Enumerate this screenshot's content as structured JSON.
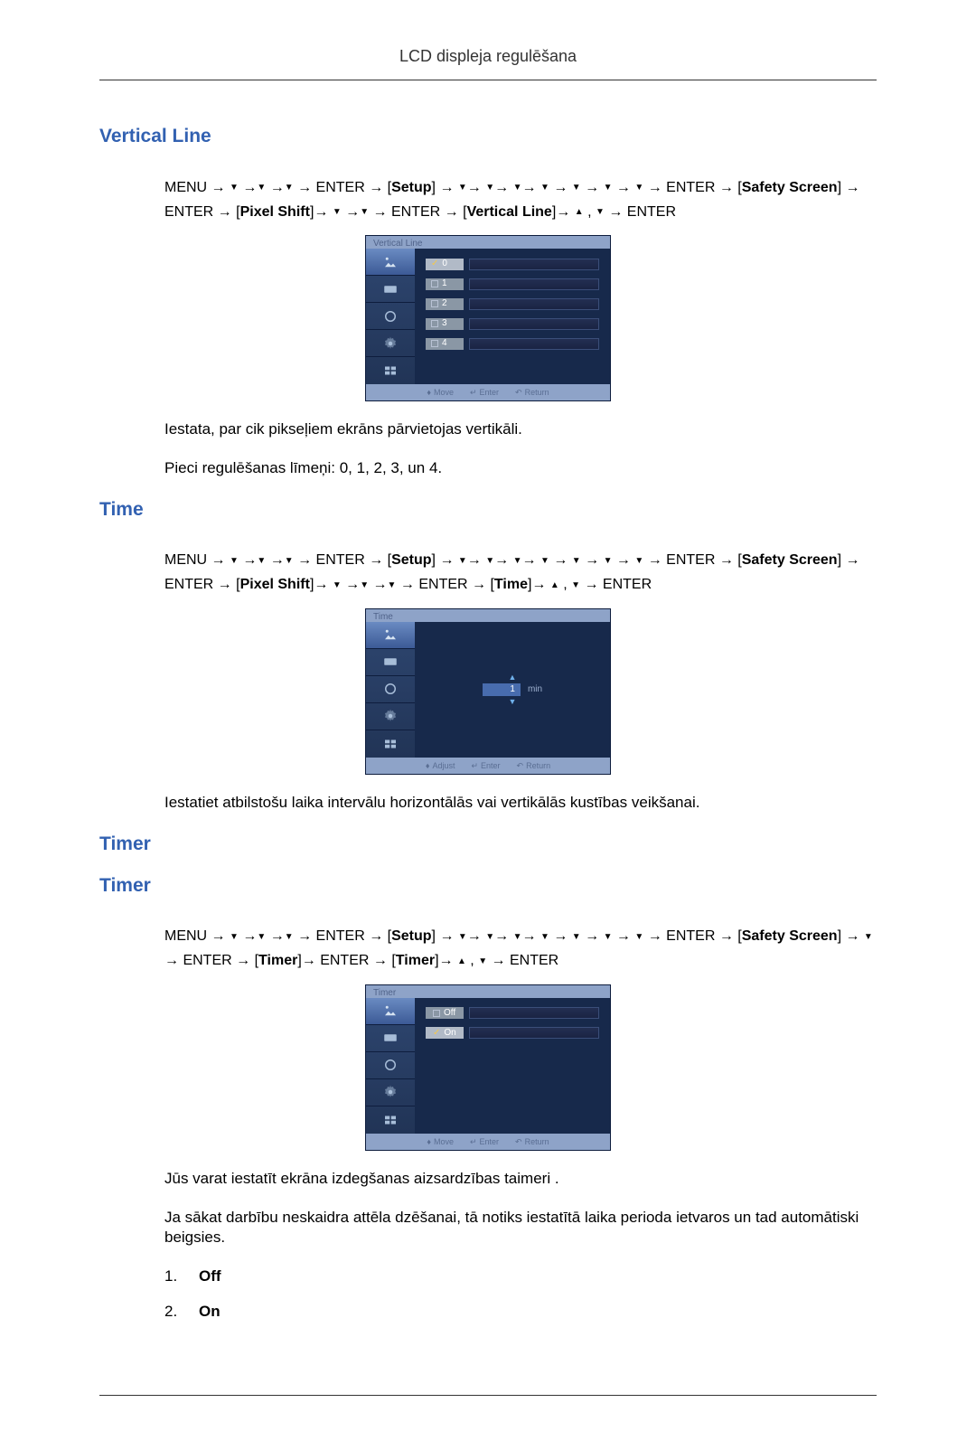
{
  "header": {
    "title": "LCD displeja regulēšana"
  },
  "sections": {
    "vertical": {
      "title": "Vertical Line",
      "nav_prefix": "MENU → ",
      "setup": "Setup",
      "safety": "Safety Screen",
      "pixelshift": "Pixel Shift",
      "menuitem": "Vertical Line",
      "desc1": "Iestata, par cik pikseļiem ekrāns pārvietojas vertikāli.",
      "desc2": "Pieci regulēšanas līmeņi: 0, 1, 2, 3, un 4.",
      "osd_title": "Vertical Line",
      "options": [
        "0",
        "1",
        "2",
        "3",
        "4"
      ],
      "selected": 0
    },
    "time": {
      "title": "Time",
      "menuitem": "Time",
      "desc1": "Iestatiet atbilstošu laika intervālu horizontālās vai vertikālās kustības veikšanai.",
      "osd_title": "Time",
      "value": "1",
      "unit": "min"
    },
    "timer": {
      "title1": "Timer",
      "title2": "Timer",
      "menuitem": "Timer",
      "submenu": "Timer",
      "desc1": "Jūs varat iestatīt ekrāna izdegšanas aizsardzības taimeri .",
      "desc2": "Ja sākat darbību neskaidra attēla dzēšanai, tā notiks iestatītā laika perioda ietvaros un tad automātiski beigsies.",
      "osd_title": "Timer",
      "options": [
        "Off",
        "On"
      ],
      "selected": 1,
      "list": [
        {
          "num": "1.",
          "label": "Off"
        },
        {
          "num": "2.",
          "label": "On"
        }
      ]
    }
  },
  "buttons": {
    "enter": "ENTER"
  },
  "footer_hints": {
    "move": "Move",
    "adjust": "Adjust",
    "enter": "Enter",
    "return": "Return"
  }
}
